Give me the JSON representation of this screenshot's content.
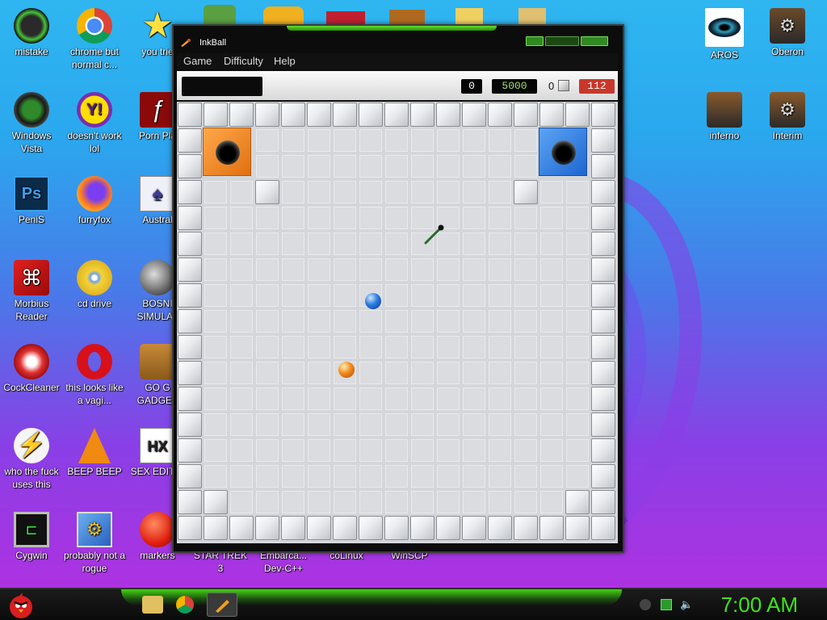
{
  "desktop": {
    "icons": [
      {
        "label": "mistake",
        "icon": "green-circle-icon"
      },
      {
        "label": "chrome but normal c...",
        "icon": "chrome-icon"
      },
      {
        "label": "you trie",
        "icon": "star-icon"
      },
      {
        "label": "Windows Vista",
        "icon": "recycle-icon"
      },
      {
        "label": "doesn't work lol",
        "icon": "yahoo-icon"
      },
      {
        "label": "Porn Pla",
        "icon": "flash-icon"
      },
      {
        "label": "PeniS",
        "icon": "photoshop-icon"
      },
      {
        "label": "furryfox",
        "icon": "firefox-icon"
      },
      {
        "label": "Austral",
        "icon": "spider-solitaire-icon"
      },
      {
        "label": "Morbius Reader",
        "icon": "pdf-icon"
      },
      {
        "label": "cd drive",
        "icon": "cd-icon"
      },
      {
        "label": "BOSNI SIMULAT",
        "icon": "mine-icon"
      },
      {
        "label": "CockCleaner",
        "icon": "ccleaner-icon"
      },
      {
        "label": "this looks like a vagi...",
        "icon": "opera-icon"
      },
      {
        "label": "GO G GADGET",
        "icon": "briefcase-icon"
      },
      {
        "label": "who the fuck uses this",
        "icon": "lightning-icon"
      },
      {
        "label": "BEEP BEEP",
        "icon": "vlc-icon"
      },
      {
        "label": "SEX EDITIC",
        "icon": "hxd-icon"
      },
      {
        "label": "Cygwin",
        "icon": "terminal-icon"
      },
      {
        "label": "probably not a rogue",
        "icon": "settings-monitor-icon"
      },
      {
        "label": "markers",
        "icon": "marker-icon"
      },
      {
        "label": "STAR TREK 3",
        "icon": "app-icon"
      },
      {
        "label": "Embarca... Dev-C++",
        "icon": "app-icon"
      },
      {
        "label": "coLinux",
        "icon": "app-icon"
      },
      {
        "label": "WinSCP",
        "icon": "app-icon"
      },
      {
        "label": "AROS",
        "icon": "eye-icon"
      },
      {
        "label": "Oberon",
        "icon": "gear-window-icon"
      },
      {
        "label": "inferno",
        "icon": "window-icon"
      },
      {
        "label": "Interim",
        "icon": "gear-window-icon"
      }
    ]
  },
  "window": {
    "title": "InkBall",
    "menu": [
      "Game",
      "Difficulty",
      "Help"
    ],
    "score_left": "0",
    "target_score": "5000",
    "balls_count": "0",
    "timer": "112"
  },
  "colors": {
    "orange": "#f28a1e",
    "blue": "#2a7ae0",
    "accent_green": "#41e21c"
  },
  "taskbar": {
    "clock": "7:00 AM"
  }
}
